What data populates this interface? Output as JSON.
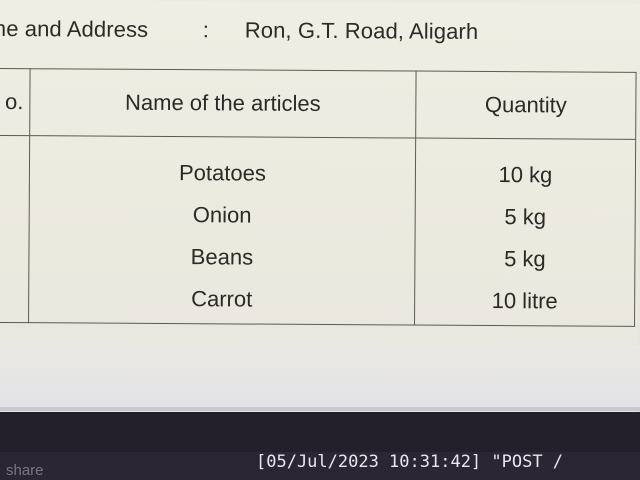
{
  "document": {
    "name_label": "me and Address",
    "separator": ":",
    "name_value": "Ron, G.T. Road, Aligarh",
    "table": {
      "headers": [
        "o.",
        "Name of the articles",
        "Quantity"
      ],
      "articles": [
        "Potatoes",
        "Onion",
        "Beans",
        "Carrot"
      ],
      "quantities": [
        "10 kg",
        "5 kg",
        "5 kg",
        "10 litre"
      ]
    }
  },
  "terminal": {
    "left_text": "share",
    "log_text": "[05/Jul/2023 10:31:42] \"POST /"
  }
}
